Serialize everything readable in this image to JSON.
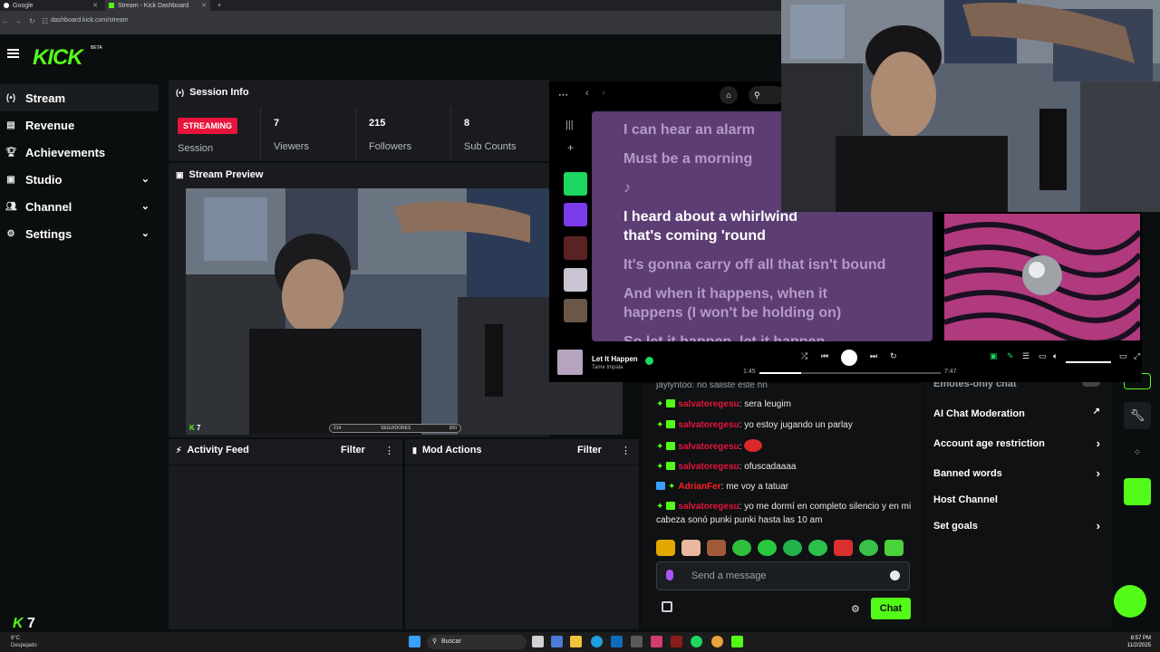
{
  "browser": {
    "tabs": [
      {
        "label": "Google",
        "active": false
      },
      {
        "label": "Stream - Kick Dashboard",
        "active": true
      }
    ],
    "new_tab": "+",
    "url": "dashboard.kick.com/stream"
  },
  "brand": {
    "logo": "KICK",
    "beta": "BETA",
    "accent": "#53fc18"
  },
  "sidebar": {
    "items": [
      {
        "label": "Stream",
        "icon": "broadcast-icon",
        "active": true,
        "expandable": false
      },
      {
        "label": "Revenue",
        "icon": "chart-icon",
        "active": false,
        "expandable": false
      },
      {
        "label": "Achievements",
        "icon": "trophy-icon",
        "active": false,
        "expandable": false
      },
      {
        "label": "Studio",
        "icon": "studio-icon",
        "active": false,
        "expandable": true
      },
      {
        "label": "Channel",
        "icon": "users-icon",
        "active": false,
        "expandable": true
      },
      {
        "label": "Settings",
        "icon": "gear-icon",
        "active": false,
        "expandable": true
      }
    ]
  },
  "session_info": {
    "title": "Session Info",
    "status": "STREAMING",
    "session_label": "Session",
    "stats": [
      {
        "value": "7",
        "label": "Viewers"
      },
      {
        "value": "215",
        "label": "Followers"
      },
      {
        "value": "8",
        "label": "Sub Counts"
      }
    ]
  },
  "stream_preview": {
    "title": "Stream Preview",
    "viewer_count": "7",
    "follower_bar": "SEGUIDORES",
    "follower_bar_left": "214",
    "follower_bar_right": "300"
  },
  "activity_feed": {
    "title": "Activity Feed",
    "filter": "Filter"
  },
  "mod_actions": {
    "title": "Mod Actions",
    "filter": "Filter"
  },
  "spotify": {
    "lyrics": [
      {
        "text": "I can hear an alarm",
        "active": false
      },
      {
        "text": "Must be a morning",
        "active": false
      },
      {
        "text": "♪",
        "active": false
      },
      {
        "text": "I heard about a whirlwind",
        "active": true
      },
      {
        "text": "that's coming 'round",
        "active": true
      },
      {
        "text": "It's gonna carry off all that isn't bound",
        "active": false
      },
      {
        "text": "And when it happens, when it",
        "active": false
      },
      {
        "text": "happens (I won't be holding on)",
        "active": false
      },
      {
        "text": "So let it happen, let it happen",
        "active": false
      }
    ],
    "track": "Let It Happen",
    "artist": "Tame Impala",
    "time_elapsed": "1:45",
    "time_total": "7:47",
    "progress": 0.23,
    "lyrics_bg": "#5c3d74"
  },
  "chat": {
    "partial_top": "jaylyntoo: no saliste este hn",
    "messages": [
      {
        "user": "salvatoregesu",
        "text": "sera leugim"
      },
      {
        "user": "salvatoregesu",
        "text": "yo estoy jugando un parlay"
      },
      {
        "user": "salvatoregesu",
        "text": "[emote]"
      },
      {
        "user": "salvatoregesu",
        "text": "ofuscadaaaa"
      },
      {
        "user": "AdrianFer",
        "text": "me voy a tatuar"
      },
      {
        "user": "salvatoregesu",
        "text": "yo me dormí en completo silencio y en mi cabeza sonó punki punki hasta las 10 am"
      }
    ],
    "placeholder": "Send a message",
    "send_label": "Chat"
  },
  "settings_panel": {
    "partial_top": "Emotes-only chat",
    "rows": [
      {
        "label": "AI Chat Moderation",
        "action": "external-link-icon"
      },
      {
        "label": "Account age restriction",
        "action": "chevron-right-icon"
      },
      {
        "label": "Banned words",
        "action": "chevron-right-icon"
      },
      {
        "label": "Host Channel",
        "action": ""
      },
      {
        "label": "Set goals",
        "action": "chevron-right-icon"
      }
    ]
  },
  "bottom_kick_count": "7",
  "taskbar": {
    "search": "Buscar",
    "weather_temp": "8°C",
    "weather_desc": "Despejado",
    "time": "8:57 PM",
    "date": "11/2/2025"
  }
}
